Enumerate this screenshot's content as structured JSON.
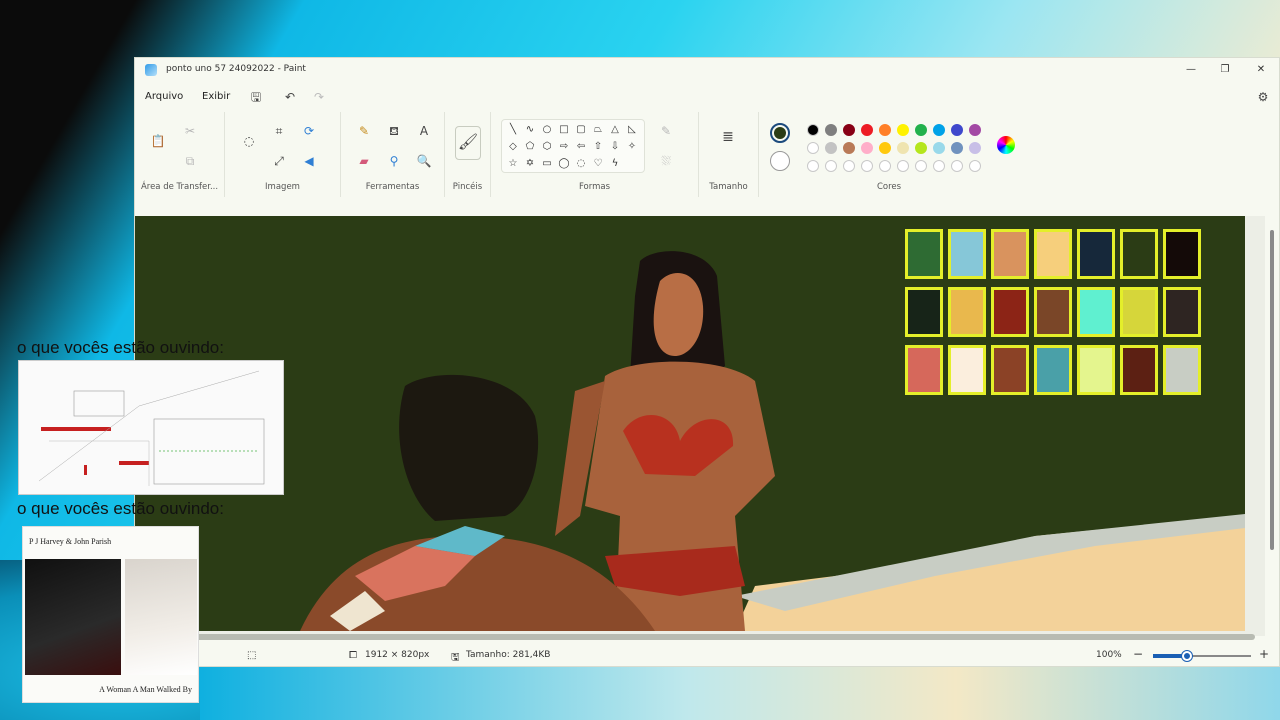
{
  "window": {
    "title": "ponto uno 57 24092022 - Paint",
    "controls": [
      "—",
      "❐",
      "✕"
    ]
  },
  "menu": {
    "file": "Arquivo",
    "view": "Exibir"
  },
  "ribbon": {
    "clipboard": "Área de Transfer...",
    "image": "Imagem",
    "tools": "Ferramentas",
    "brushes": "Pincéis",
    "shapes": "Formas",
    "size": "Tamanho",
    "colors": "Cores",
    "text_tool_glyph": "A"
  },
  "colors": {
    "primary": "#2b3c15",
    "secondary": "#ffffff",
    "row1": [
      "#000000",
      "#7f7f7f",
      "#880015",
      "#ed1c24",
      "#ff7f27",
      "#fff200",
      "#22b14c",
      "#00a2e8",
      "#3f48cc",
      "#a349a4"
    ],
    "row2": [
      "#ffffff",
      "#c3c3c3",
      "#b97a57",
      "#ffaec9",
      "#ffc90e",
      "#efe4b0",
      "#b5e61d",
      "#99d9ea",
      "#7092be",
      "#c8bfe7"
    ],
    "row3": [
      "#ffffff",
      "#ffffff",
      "#ffffff",
      "#ffffff",
      "#ffffff",
      "#ffffff",
      "#ffffff",
      "#ffffff",
      "#ffffff",
      "#ffffff"
    ]
  },
  "canvas_palette": [
    [
      "#2e6b33",
      "#86c7d8",
      "#d9935e",
      "#f6cf7c",
      "#16283a",
      "#2b3c15",
      "#140a08"
    ],
    [
      "#172418",
      "#e9b84d",
      "#8c2416",
      "#7a4628",
      "#5ff0d0",
      "#d6d63a",
      "#2e2522"
    ],
    [
      "#d6685b",
      "#fbeedd",
      "#8b4226",
      "#4aa0a8",
      "#e4f58e",
      "#5c2013",
      "#c8cdc4"
    ]
  ],
  "status": {
    "dimensions": "1912 × 820px",
    "size": "Tamanho: 281,4KB",
    "zoom": "100%",
    "zoom_level": 0.37
  },
  "overlay": {
    "caption1": "o que vocês estão ouvindo:",
    "caption2": "o que vocês estão ouvindo:",
    "album_top": "P J Harvey & John Parish",
    "album_bottom": "A Woman A Man Walked By"
  }
}
